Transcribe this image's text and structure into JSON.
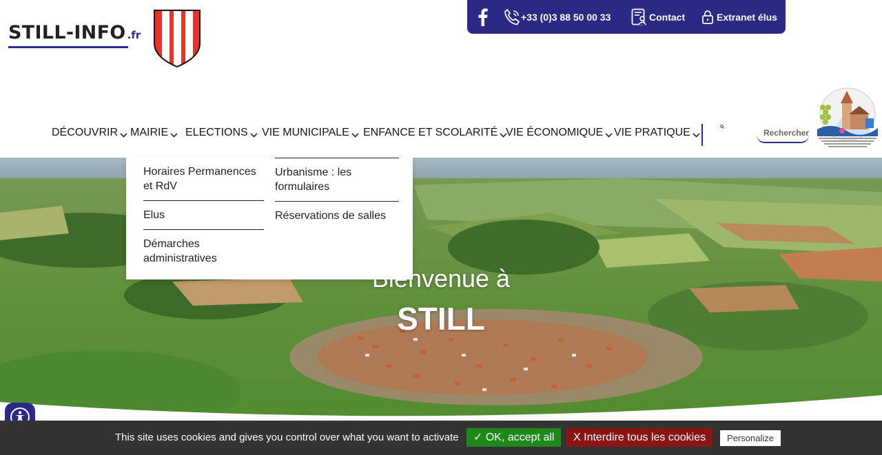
{
  "header": {
    "logo_main": "STILL-INFO",
    "logo_tld": ".fr"
  },
  "topbar": {
    "phone": "+33 (0)3 88 50 00 33",
    "contact": "Contact",
    "extranet": "Extranet élus",
    "color": "#2a2a86"
  },
  "nav": {
    "items": [
      {
        "label": "DÉCOUVRIR"
      },
      {
        "label": "MAIRIE"
      },
      {
        "label": "ELECTIONS"
      },
      {
        "label": "VIE MUNICIPALE"
      },
      {
        "label": "ENFANCE ET SCOLARITÉ"
      },
      {
        "label": "VIE ÉCONOMIQUE"
      },
      {
        "label": "VIE PRATIQUE"
      }
    ],
    "search_placeholder": "Rechercher"
  },
  "dropdown": {
    "col1": [
      "Horaires Permanences et RdV",
      "Elus",
      "Démarches administratives"
    ],
    "col2": [
      "Urbanisme : les formulaires",
      "Réservations de salles"
    ]
  },
  "hero": {
    "subtitle": "Bienvenue à",
    "title": "STILL"
  },
  "cookie": {
    "text": "This site uses cookies and gives you control over what you want to activate",
    "accept": "✓ OK, accept all",
    "deny": "X Interdire tous les cookies",
    "personalize": "Personalize"
  },
  "icons": {
    "facebook": "facebook-icon",
    "phone": "phone-icon",
    "contact": "contact-icon",
    "lock": "lock-icon",
    "search": "search-icon",
    "accessibility": "accessibility-icon"
  }
}
